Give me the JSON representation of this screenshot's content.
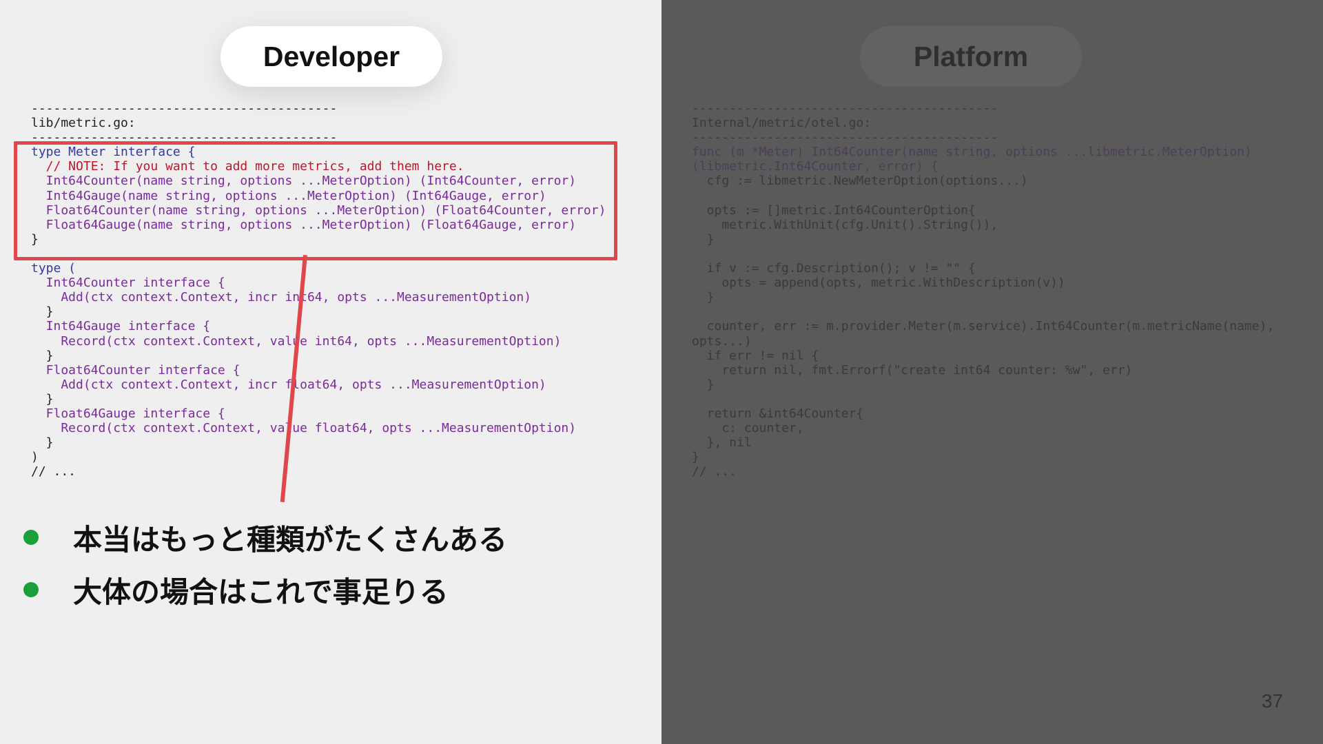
{
  "slide": {
    "developer_label": "Developer",
    "platform_label": "Platform",
    "page_number": "37",
    "bullets": [
      "本当はもっと種類がたくさんある",
      "大体の場合はこれで事足りる"
    ],
    "colors": {
      "left_bg": "#efefef",
      "right_bg": "#5a5a5a",
      "highlight": "#e0474c",
      "bullet_dot": "#1aa03a"
    }
  },
  "left_code": {
    "lines": [
      "-----------------------------------------",
      "lib/metric.go:",
      "-----------------------------------------",
      "type Meter interface {",
      "  // NOTE: If you want to add more metrics, add them here.",
      "  Int64Counter(name string, options ...MeterOption) (Int64Counter, error)",
      "  Int64Gauge(name string, options ...MeterOption) (Int64Gauge, error)",
      "  Float64Counter(name string, options ...MeterOption) (Float64Counter, error)",
      "  Float64Gauge(name string, options ...MeterOption) (Float64Gauge, error)",
      "}",
      "",
      "type (",
      "  Int64Counter interface {",
      "    Add(ctx context.Context, incr int64, opts ...MeasurementOption)",
      "  }",
      "  Int64Gauge interface {",
      "    Record(ctx context.Context, value int64, opts ...MeasurementOption)",
      "  }",
      "  Float64Counter interface {",
      "    Add(ctx context.Context, incr float64, opts ...MeasurementOption)",
      "  }",
      "  Float64Gauge interface {",
      "    Record(ctx context.Context, value float64, opts ...MeasurementOption)",
      "  }",
      ")",
      "// ..."
    ]
  },
  "right_code": {
    "lines": [
      "-----------------------------------------",
      "Internal/metric/otel.go:",
      "-----------------------------------------",
      "func (m *Meter) Int64Counter(name string, options ...libmetric.MeterOption)",
      "(libmetric.Int64Counter, error) {",
      "  cfg := libmetric.NewMeterOption(options...)",
      "",
      "  opts := []metric.Int64CounterOption{",
      "    metric.WithUnit(cfg.Unit().String()),",
      "  }",
      "",
      "  if v := cfg.Description(); v != \"\" {",
      "    opts = append(opts, metric.WithDescription(v))",
      "  }",
      "",
      "  counter, err := m.provider.Meter(m.service).Int64Counter(m.metricName(name),",
      "opts...)",
      "  if err != nil {",
      "    return nil, fmt.Errorf(\"create int64 counter: %w\", err)",
      "  }",
      "",
      "  return &int64Counter{",
      "    c: counter,",
      "  }, nil",
      "}",
      "// ..."
    ]
  }
}
